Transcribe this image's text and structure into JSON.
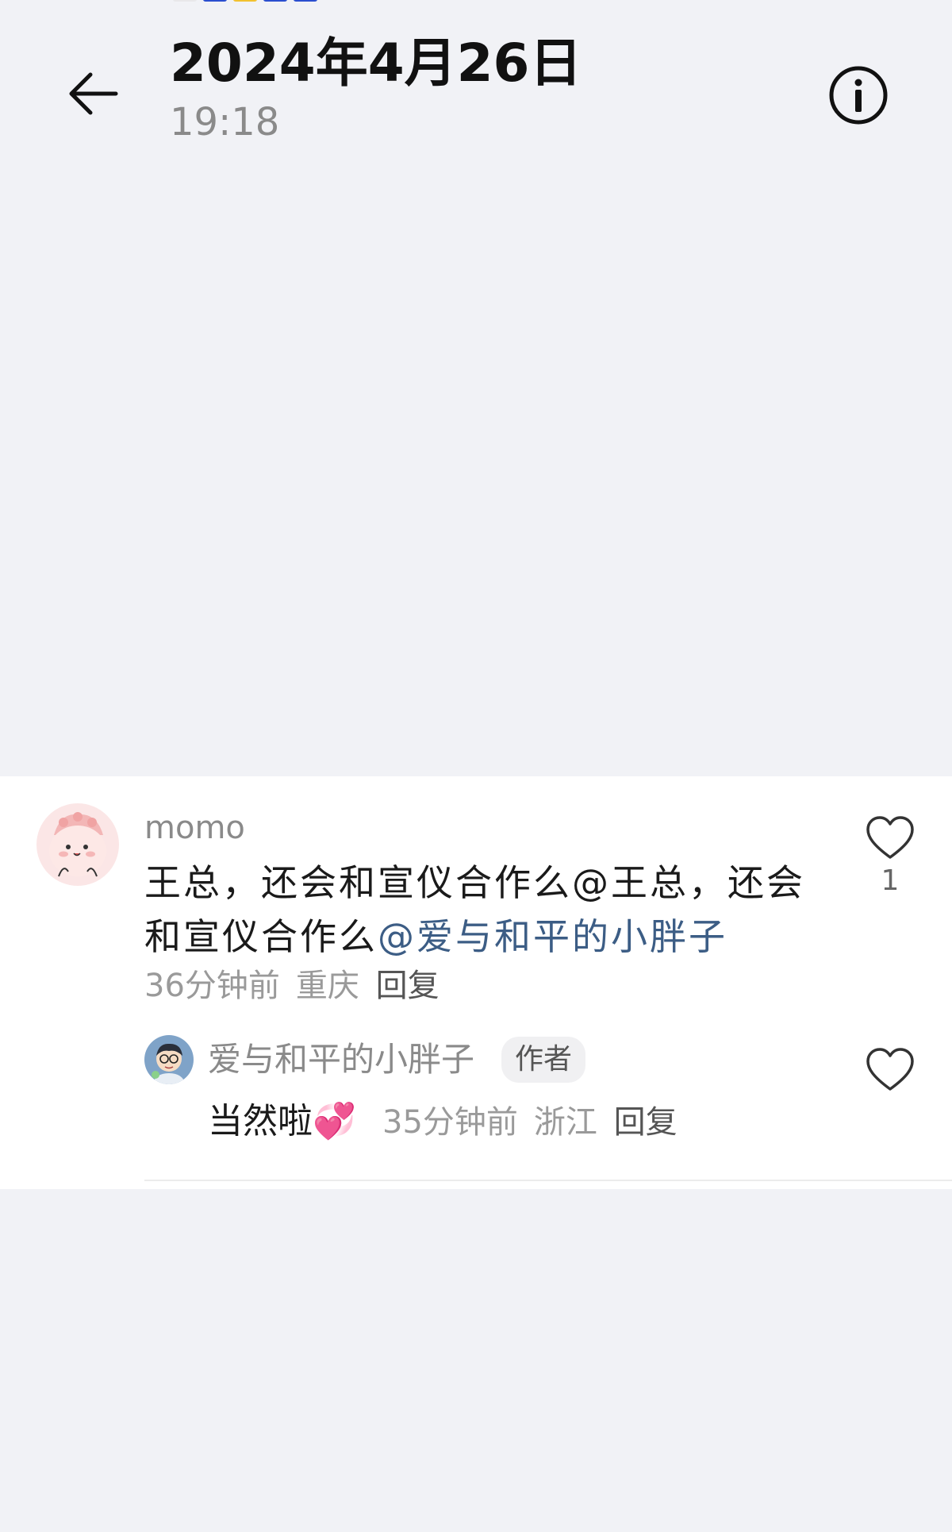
{
  "header": {
    "date": "2024年4月26日",
    "time": "19:18"
  },
  "comment": {
    "author": "momo",
    "text_prefix": "王总，还会和宣仪合作么@王总，还会和宣仪合作么",
    "mention": "@爱与和平的小胖子",
    "time_ago": "36分钟前",
    "location": "重庆",
    "reply_label": "回复",
    "like_count": "1",
    "avatar_icon": "cartoon-pink-avatar"
  },
  "reply": {
    "author": "爱与和平的小胖子",
    "badge": "作者",
    "text": "当然啦",
    "emoji": "💞",
    "time_ago": "35分钟前",
    "location": "浙江",
    "reply_label": "回复",
    "avatar_icon": "cartoon-boy-avatar"
  },
  "colors": {
    "background": "#f1f2f6",
    "card": "#ffffff",
    "mention": "#3c5d85",
    "meta": "#9a9a9a"
  }
}
